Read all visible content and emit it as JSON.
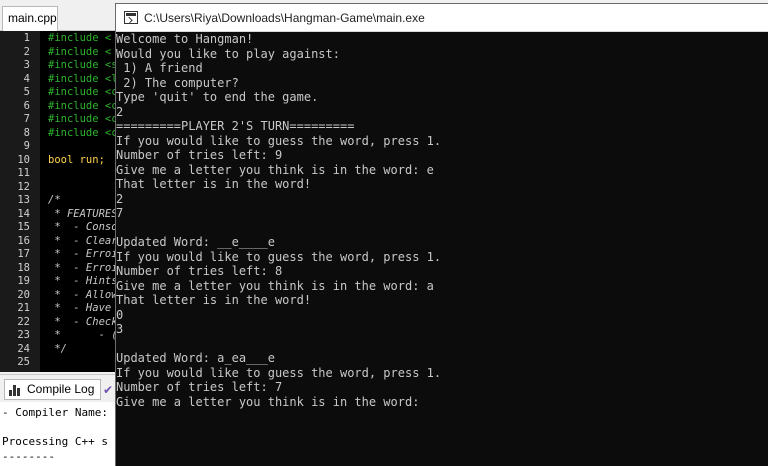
{
  "ide": {
    "file_tab": "main.cpp",
    "gutter_numbers": [
      "1",
      "2",
      "3",
      "4",
      "5",
      "6",
      "7",
      "8",
      "9",
      "10",
      "11",
      "12",
      "13",
      "14",
      "15",
      "16",
      "17",
      "18",
      "19",
      "20",
      "21",
      "22",
      "23",
      "24",
      "25"
    ],
    "code_lines": [
      {
        "text": "#include <",
        "style": "inc"
      },
      {
        "text": "#include <",
        "style": "inc"
      },
      {
        "text": "#include <s",
        "style": "inc"
      },
      {
        "text": "#include <l",
        "style": "inc"
      },
      {
        "text": "#include <c",
        "style": "inc"
      },
      {
        "text": "#include <c",
        "style": "inc"
      },
      {
        "text": "#include <c",
        "style": "inc"
      },
      {
        "text": "#include <c",
        "style": "inc"
      },
      {
        "text": "",
        "style": "inc"
      },
      {
        "text": "bool run;",
        "style": "kw"
      },
      {
        "text": "",
        "style": "kw"
      },
      {
        "text": "",
        "style": "kw"
      },
      {
        "text": "/*",
        "style": "cm"
      },
      {
        "text": " * FEATURES",
        "style": "cm"
      },
      {
        "text": " *  - Conso",
        "style": "cm"
      },
      {
        "text": " *  - Clear",
        "style": "cm"
      },
      {
        "text": " *  - Erroi",
        "style": "cm"
      },
      {
        "text": " *  - Erroi",
        "style": "cm"
      },
      {
        "text": " *  - Hints",
        "style": "cm"
      },
      {
        "text": " *  - Allow",
        "style": "cm"
      },
      {
        "text": " *  - Have",
        "style": "cm"
      },
      {
        "text": " *  - Check",
        "style": "cm"
      },
      {
        "text": " *      - (",
        "style": "cm"
      },
      {
        "text": " */",
        "style": "cm"
      },
      {
        "text": "",
        "style": "cm"
      }
    ],
    "compile_log_tab": "Compile Log",
    "log_lines": [
      "- Compiler Name:",
      "",
      "Processing C++ s",
      "--------"
    ]
  },
  "console": {
    "title": "C:\\Users\\Riya\\Downloads\\Hangman-Game\\main.exe",
    "lines": [
      "Welcome to Hangman!",
      "Would you like to play against:",
      " 1) A friend",
      " 2) The computer?",
      "Type 'quit' to end the game.",
      "2",
      "=========PLAYER 2'S TURN=========",
      "If you would like to guess the word, press 1.",
      "Number of tries left: 9",
      "Give me a letter you think is in the word: e",
      "That letter is in the word!",
      "2",
      "7",
      "",
      "Updated Word: __e____e",
      "If you would like to guess the word, press 1.",
      "Number of tries left: 8",
      "Give me a letter you think is in the word: a",
      "That letter is in the word!",
      "0",
      "3",
      "",
      "Updated Word: a_ea___e",
      "If you would like to guess the word, press 1.",
      "Number of tries left: 7",
      "Give me a letter you think is in the word:"
    ]
  }
}
